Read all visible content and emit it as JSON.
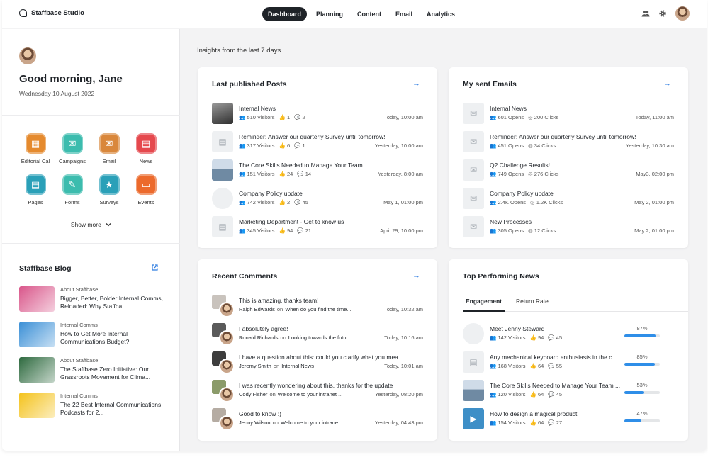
{
  "brand": "Staffbase Studio",
  "nav": [
    "Dashboard",
    "Planning",
    "Content",
    "Email",
    "Analytics"
  ],
  "sidebar": {
    "greeting": "Good morning, Jane",
    "date": "Wednesday 10 August 2022",
    "apps": [
      {
        "label": "Editorial Cal",
        "color": "#e58a2e",
        "glyph": "▦"
      },
      {
        "label": "Campaigns",
        "color": "#3cbcae",
        "glyph": "✉"
      },
      {
        "label": "Email",
        "color": "#d9873b",
        "glyph": "✉"
      },
      {
        "label": "News",
        "color": "#e5484d",
        "glyph": "▤"
      },
      {
        "label": "Pages",
        "color": "#2aa0b8",
        "glyph": "▤"
      },
      {
        "label": "Forms",
        "color": "#3cbcae",
        "glyph": "✎"
      },
      {
        "label": "Surveys",
        "color": "#2aa0b8",
        "glyph": "★"
      },
      {
        "label": "Events",
        "color": "#ec6a2c",
        "glyph": "▭"
      }
    ],
    "show_more": "Show more",
    "blog_title": "Staffbase Blog",
    "blog": [
      {
        "category": "About Staffbase",
        "title": "Bigger, Better, Bolder Internal Comms, Reloaded: Why Staffba...",
        "color": "#d9568a"
      },
      {
        "category": "Internal Comms",
        "title": "How to Get More Internal Communications Budget?",
        "color": "#3a8fd6"
      },
      {
        "category": "About Staffbase",
        "title": "The Staffbase Zero Initiative: Our Grassroots Movement for Clima...",
        "color": "#2e6a3f"
      },
      {
        "category": "Internal Comms",
        "title": "The 22 Best Internal Communications Podcasts for 2...",
        "color": "#f4c21a"
      }
    ]
  },
  "main": {
    "insights": "Insights from the last 7 days",
    "posts": {
      "title": "Last published Posts",
      "rows": [
        {
          "title": "Internal News",
          "visitors": "510 Visitors",
          "likes": "1",
          "comments": "2",
          "time": "Today, 10:00 am"
        },
        {
          "title": "Reminder: Answer our quarterly Survey until tomorrow!",
          "visitors": "317 Visitors",
          "likes": "6",
          "comments": "1",
          "time": "Yesterday, 10:00 am"
        },
        {
          "title": "The Core Skills Needed to Manage Your Team ...",
          "visitors": "151 Visitors",
          "likes": "24",
          "comments": "14",
          "time": "Yesterday, 8:00 am"
        },
        {
          "title": "Company Policy update",
          "visitors": "742 Visitors",
          "likes": "2",
          "comments": "45",
          "time": "May 1, 01:00 pm"
        },
        {
          "title": "Marketing Department - Get to know us",
          "visitors": "345 Visitors",
          "likes": "94",
          "comments": "21",
          "time": "April 29, 10:00 pm"
        }
      ]
    },
    "emails": {
      "title": "My sent Emails",
      "rows": [
        {
          "title": "Internal News",
          "opens": "601 Opens",
          "clicks": "200 Clicks",
          "time": "Today, 11:00 am"
        },
        {
          "title": "Reminder: Answer our quarterly Survey until tomorrow!",
          "opens": "451 Opens",
          "clicks": "34 Clicks",
          "time": "Yesterday, 10:30 am"
        },
        {
          "title": "Q2 Challenge Results!",
          "opens": "749 Opens",
          "clicks": "276 Clicks",
          "time": "May3, 02:00 pm"
        },
        {
          "title": "Company Policy update",
          "opens": "2.4K Opens",
          "clicks": "1.2K Clicks",
          "time": "May 2, 01:00 pm"
        },
        {
          "title": "New Processes",
          "opens": "305 Opens",
          "clicks": "12 Clicks",
          "time": "May 2, 01:00 pm"
        }
      ]
    },
    "comments": {
      "title": "Recent Comments",
      "rows": [
        {
          "text": "This is amazing, thanks team!",
          "author": "Ralph Edwards",
          "on": "on",
          "target": "When do you find the time...",
          "time": "Today, 10:32 am"
        },
        {
          "text": "I absolutely agree!",
          "author": "Ronald Richards",
          "on": "on",
          "target": "Looking towards the futu...",
          "time": "Today, 10:16 am"
        },
        {
          "text": "I have a question about this: could you clarify what you mea...",
          "author": "Jeremy Smith",
          "on": "on",
          "target": "Internal News",
          "time": "Today, 10:01 am"
        },
        {
          "text": "I was recently wondering about this, thanks for the update",
          "author": "Cody Fisher",
          "on": "on",
          "target": "Welcome to your intranet ...",
          "time": "Yesterday, 08:20 pm"
        },
        {
          "text": "Good to know :)",
          "author": "Jenny Wilson",
          "on": "on",
          "target": "Welcome to your intrane...",
          "time": "Yesterday, 04:43 pm"
        }
      ]
    },
    "top_news": {
      "title": "Top Performing News",
      "tabs": [
        "Engagement",
        "Return Rate"
      ],
      "rows": [
        {
          "title": "Meet Jenny Steward",
          "visitors": "142 Visitors",
          "likes": "94",
          "comments": "45",
          "pct": "87%",
          "value": 0.87
        },
        {
          "title": "Any mechanical keyboard enthusiasts in the c...",
          "visitors": "168 Visitors",
          "likes": "64",
          "comments": "55",
          "pct": "85%",
          "value": 0.85
        },
        {
          "title": "The Core Skills Needed to Manage Your Team ...",
          "visitors": "120 Visitors",
          "likes": "64",
          "comments": "45",
          "pct": "53%",
          "value": 0.53
        },
        {
          "title": "How to design a magical product",
          "visitors": "154 Visitors",
          "likes": "64",
          "comments": "27",
          "pct": "47%",
          "value": 0.47
        }
      ]
    }
  }
}
